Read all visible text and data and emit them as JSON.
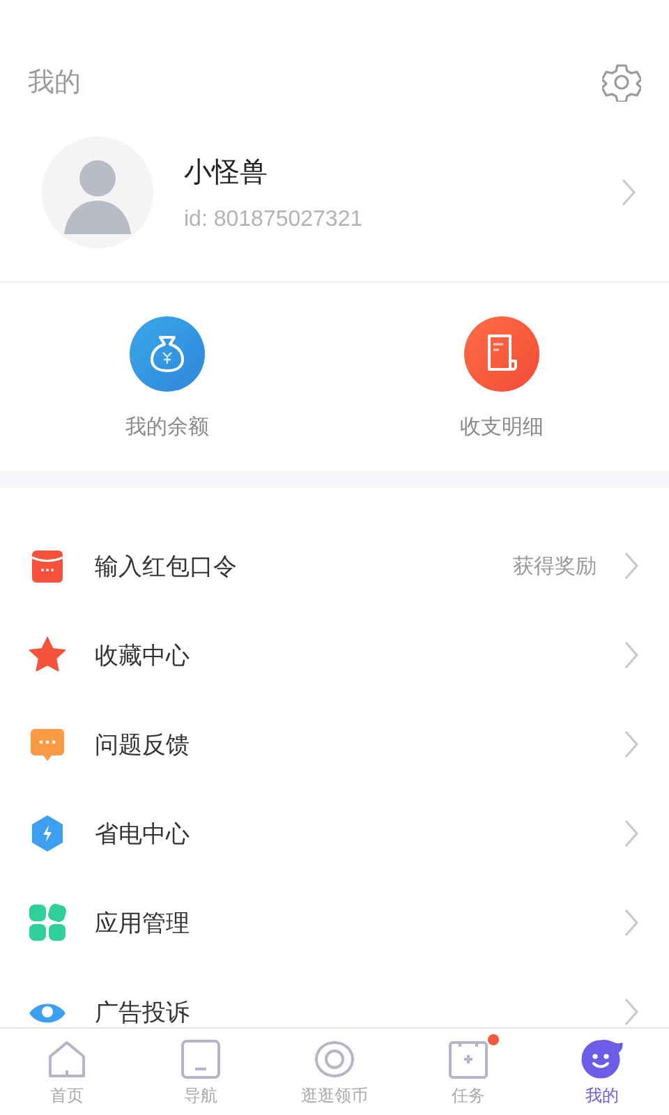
{
  "header": {
    "title": "我的"
  },
  "profile": {
    "name": "小怪兽",
    "id_text": "id: 801875027321"
  },
  "actions": [
    {
      "kind": "wallet",
      "label": "我的余额"
    },
    {
      "kind": "bill",
      "label": "收支明细"
    }
  ],
  "menu": [
    {
      "kind": "envelope",
      "label": "输入红包口令",
      "hint": "获得奖励"
    },
    {
      "kind": "star",
      "label": "收藏中心"
    },
    {
      "kind": "chat",
      "label": "问题反馈"
    },
    {
      "kind": "bolt",
      "label": "省电中心"
    },
    {
      "kind": "apps",
      "label": "应用管理"
    },
    {
      "kind": "eye",
      "label": "广告投诉"
    }
  ],
  "tabs": [
    {
      "kind": "home",
      "label": "首页",
      "selected": false,
      "dot": false
    },
    {
      "kind": "nav",
      "label": "导航",
      "selected": false,
      "dot": false
    },
    {
      "kind": "eye",
      "label": "逛逛领币",
      "selected": false,
      "dot": false
    },
    {
      "kind": "task",
      "label": "任务",
      "selected": false,
      "dot": true
    },
    {
      "kind": "me",
      "label": "我的",
      "selected": true,
      "dot": false
    }
  ]
}
